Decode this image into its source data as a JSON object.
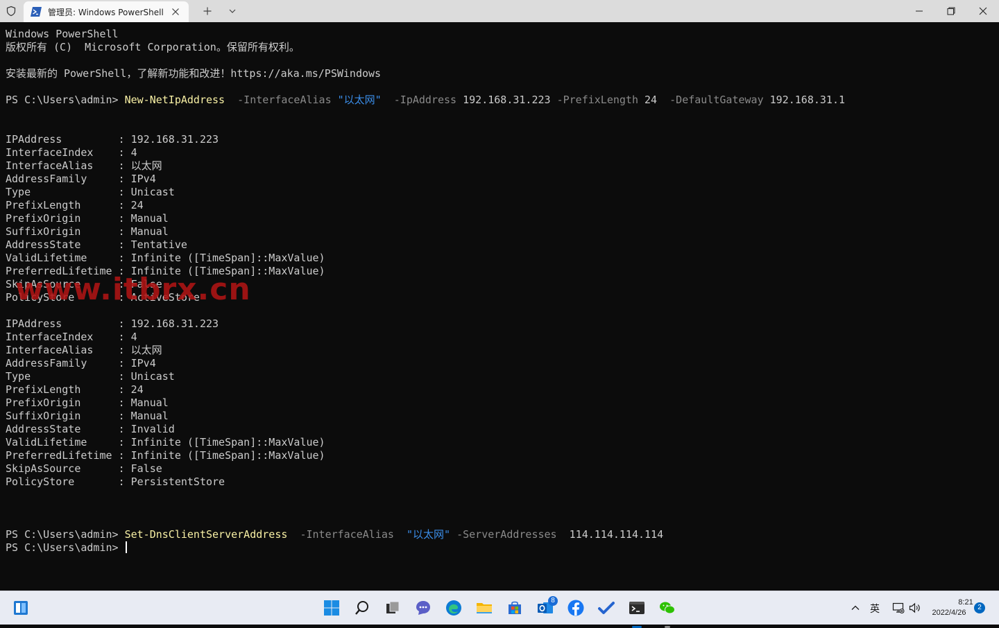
{
  "window": {
    "tab_title": "管理员: Windows PowerShell"
  },
  "terminal": {
    "banner_line1": "Windows PowerShell",
    "banner_line2": "版权所有 (C)  Microsoft Corporation。保留所有权利。",
    "banner_line3": "安装最新的 PowerShell，了解新功能和改进！https://aka.ms/PSWindows",
    "prompt": "PS C:\\Users\\admin> ",
    "command1": {
      "cmdlet": "New-NetIpAddress",
      "p1": "  -InterfaceAlias ",
      "v1": "\"以太网\"",
      "p2": "  -IpAddress ",
      "v2": "192.168.31.223",
      "p3": " -PrefixLength ",
      "v3": "24",
      "p4": "  -DefaultGateway ",
      "v4": "192.168.31.1"
    },
    "block1": [
      {
        "k": "IPAddress         ",
        "v": "192.168.31.223"
      },
      {
        "k": "InterfaceIndex    ",
        "v": "4"
      },
      {
        "k": "InterfaceAlias    ",
        "v": "以太网"
      },
      {
        "k": "AddressFamily     ",
        "v": "IPv4"
      },
      {
        "k": "Type              ",
        "v": "Unicast"
      },
      {
        "k": "PrefixLength      ",
        "v": "24"
      },
      {
        "k": "PrefixOrigin      ",
        "v": "Manual"
      },
      {
        "k": "SuffixOrigin      ",
        "v": "Manual"
      },
      {
        "k": "AddressState      ",
        "v": "Tentative"
      },
      {
        "k": "ValidLifetime     ",
        "v": "Infinite ([TimeSpan]::MaxValue)"
      },
      {
        "k": "PreferredLifetime ",
        "v": "Infinite ([TimeSpan]::MaxValue)"
      },
      {
        "k": "SkipAsSource      ",
        "v": "False"
      },
      {
        "k": "PolicyStore       ",
        "v": "ActiveStore"
      }
    ],
    "block2": [
      {
        "k": "IPAddress         ",
        "v": "192.168.31.223"
      },
      {
        "k": "InterfaceIndex    ",
        "v": "4"
      },
      {
        "k": "InterfaceAlias    ",
        "v": "以太网"
      },
      {
        "k": "AddressFamily     ",
        "v": "IPv4"
      },
      {
        "k": "Type              ",
        "v": "Unicast"
      },
      {
        "k": "PrefixLength      ",
        "v": "24"
      },
      {
        "k": "PrefixOrigin      ",
        "v": "Manual"
      },
      {
        "k": "SuffixOrigin      ",
        "v": "Manual"
      },
      {
        "k": "AddressState      ",
        "v": "Invalid"
      },
      {
        "k": "ValidLifetime     ",
        "v": "Infinite ([TimeSpan]::MaxValue)"
      },
      {
        "k": "PreferredLifetime ",
        "v": "Infinite ([TimeSpan]::MaxValue)"
      },
      {
        "k": "SkipAsSource      ",
        "v": "False"
      },
      {
        "k": "PolicyStore       ",
        "v": "PersistentStore"
      }
    ],
    "command2": {
      "cmdlet": "Set-DnsClientServerAddress",
      "p1": "  -InterfaceAlias  ",
      "v1": "\"以太网\"",
      "p2": " -ServerAddresses  ",
      "v2": "114.114.114.114"
    },
    "watermark": "www.itbrx.cn"
  },
  "taskbar": {
    "icons": [
      "widgets-icon",
      "start-icon",
      "search-icon",
      "task-view-icon",
      "teams-chat-icon",
      "edge-icon",
      "file-explorer-icon",
      "store-icon",
      "outlook-icon",
      "facebook-icon",
      "todo-icon",
      "terminal-icon",
      "wechat-icon"
    ],
    "outlook_badge": "8",
    "ime": "英",
    "time": "8:21",
    "date": "2022/4/26",
    "notifications": "2"
  },
  "colors": {
    "terminal_bg": "#0c0c0c",
    "terminal_fg": "#cccccc",
    "cmdlet": "#f9f1a5",
    "parameter": "#8a8a8a",
    "string": "#3b8eea",
    "watermark": "#af1414"
  }
}
